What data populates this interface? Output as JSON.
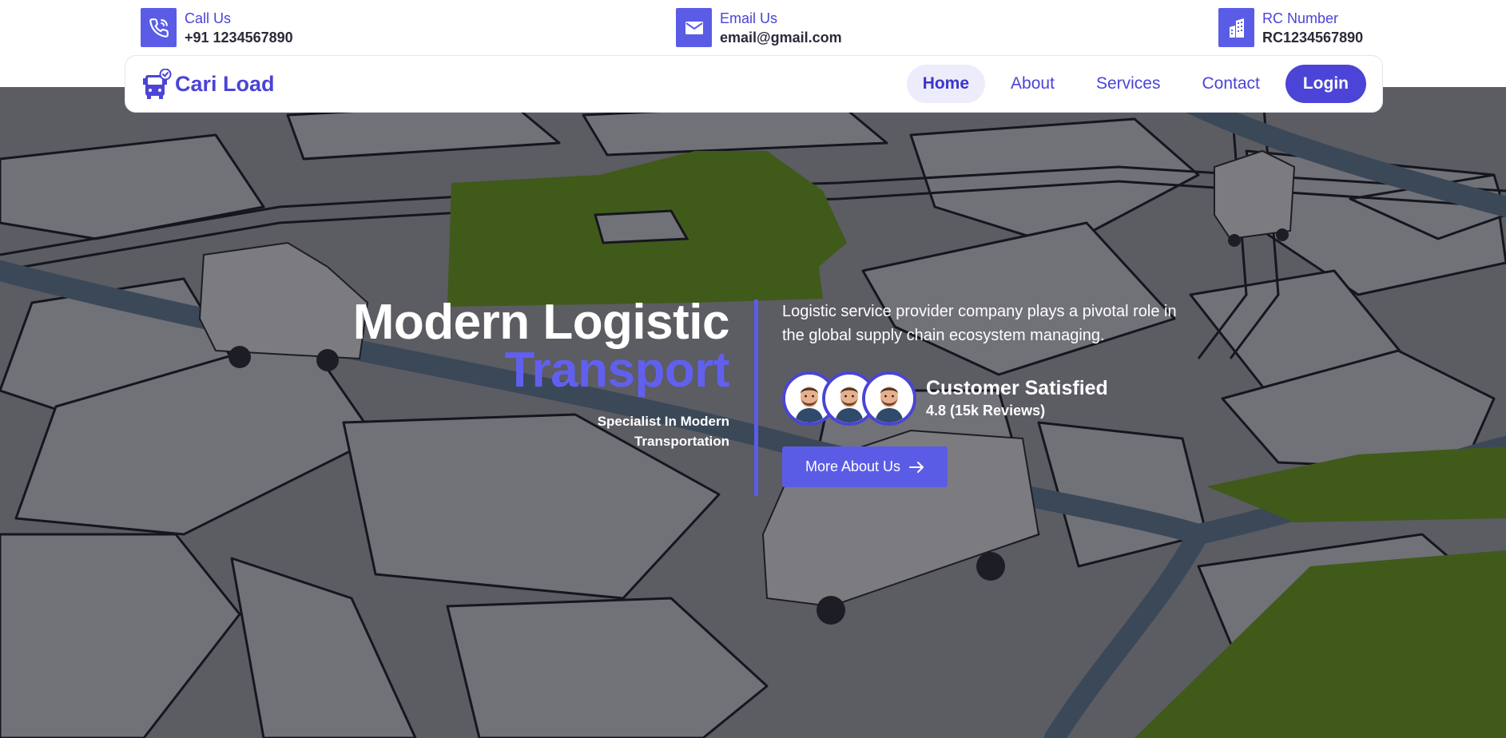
{
  "contacts": {
    "phone": {
      "label": "Call Us",
      "value": "+91 1234567890"
    },
    "email": {
      "label": "Email Us",
      "value": "email@gmail.com"
    },
    "rc": {
      "label": "RC Number",
      "value": "RC1234567890"
    }
  },
  "brand": {
    "name": "Cari Load",
    "icon": "truck-check-icon"
  },
  "nav": {
    "items": [
      {
        "label": "Home",
        "active": true
      },
      {
        "label": "About",
        "active": false
      },
      {
        "label": "Services",
        "active": false
      },
      {
        "label": "Contact",
        "active": false
      }
    ],
    "login_label": "Login"
  },
  "hero": {
    "title_line1": "Modern Logistic",
    "title_line2": "Transport",
    "subtitle_line1": "Specialist In Modern",
    "subtitle_line2": "Transportation",
    "description_line1": "Logistic service provider company plays a pivotal role in",
    "description_line2": "the global supply chain ecosystem managing.",
    "satisfaction_title": "Customer Satisfied",
    "satisfaction_rating": "4.8 (15k Reviews)",
    "cta_label": "More About Us",
    "cta_icon": "arrow-right-icon"
  },
  "colors": {
    "primary": "#4b44d6",
    "accent": "#5b5ce6",
    "title_highlight": "#6160ee",
    "map_green": "#7ab317"
  }
}
